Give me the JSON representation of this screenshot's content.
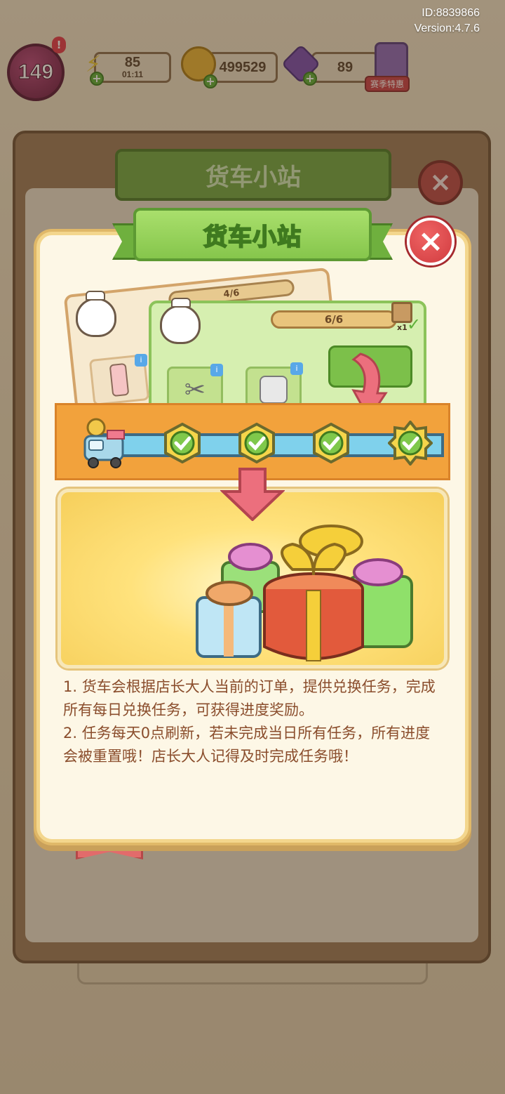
{
  "status": {
    "id_label": "ID:8839866",
    "version_label": "Version:4.7.6"
  },
  "hud": {
    "level": "149",
    "alert": "!",
    "energy": {
      "value": "85",
      "timer": "01:11"
    },
    "coins": {
      "value": "499529"
    },
    "gems": {
      "value": "89"
    },
    "season_offer_label": "赛季特惠",
    "plus_symbol": "+"
  },
  "background_panel": {
    "title": "货车小站",
    "close_symbol": "×"
  },
  "modal": {
    "title": "货车小站",
    "close_symbol": "×",
    "illustration": {
      "back_card_progress": "4/6",
      "front_card_progress": "6/6",
      "reward_count": "x1",
      "completed_checks": 4
    },
    "description": [
      "1. 货车会根据店长大人当前的订单，提供兑换任务，完成所有每日兑换任务，可获得进度奖励。",
      "2. 任务每天0点刷新，若未完成当日所有任务，所有进度会被重置哦！店长大人记得及时完成任务哦！"
    ]
  },
  "colors": {
    "title_green": "#86c64c",
    "close_red": "#d13b3f",
    "track_orange": "#f2a23c",
    "track_blue": "#7fd1ec",
    "text_brown": "#8a4d2c"
  }
}
